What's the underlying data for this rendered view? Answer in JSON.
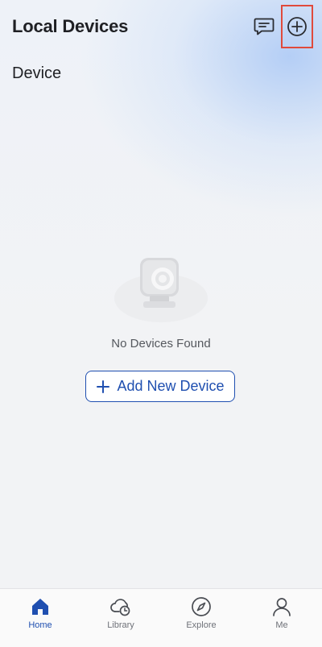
{
  "header": {
    "title": "Local Devices",
    "icons": {
      "message": "message-icon",
      "add": "plus-circle-icon"
    }
  },
  "section": {
    "label": "Device"
  },
  "empty_state": {
    "illustration": "camera-illustration",
    "text": "No Devices Found",
    "button_label": "Add New Device",
    "button_icon": "plus-icon"
  },
  "tabbar": {
    "items": [
      {
        "label": "Home",
        "icon": "home-icon",
        "active": true
      },
      {
        "label": "Library",
        "icon": "cloud-clock-icon",
        "active": false
      },
      {
        "label": "Explore",
        "icon": "compass-icon",
        "active": false
      },
      {
        "label": "Me",
        "icon": "person-icon",
        "active": false
      }
    ]
  },
  "colors": {
    "accent": "#1f4fb0",
    "highlight": "#e04a3c",
    "background": "#f2f3f5"
  }
}
